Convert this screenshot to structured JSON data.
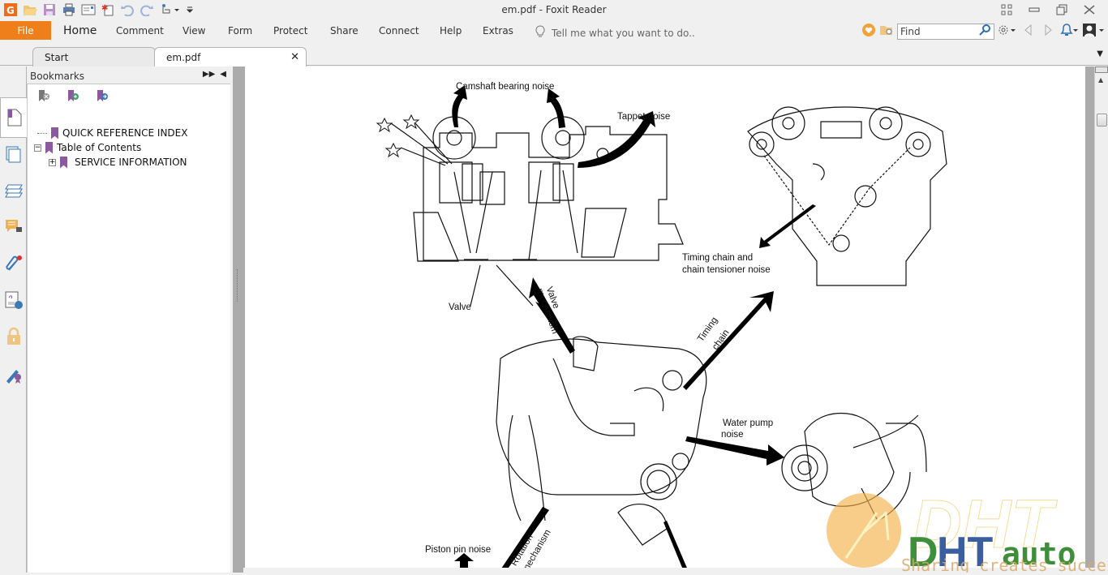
{
  "window": {
    "title": "em.pdf - Foxit Reader"
  },
  "quick_access": [
    "foxit-logo",
    "open-icon",
    "save-icon",
    "print-icon",
    "email-icon",
    "new-icon",
    "undo-icon",
    "redo-icon",
    "hand-tool-icon",
    "customize-icon"
  ],
  "ribbon": {
    "file_label": "File",
    "menus": [
      "Home",
      "Comment",
      "View",
      "Form",
      "Protect",
      "Share",
      "Connect",
      "Help",
      "Extras"
    ],
    "tell_me_placeholder": "Tell me what you want to do..",
    "find_placeholder": "Find"
  },
  "tabs": [
    {
      "label": "Start",
      "active": false
    },
    {
      "label": "em.pdf",
      "active": true
    }
  ],
  "panel": {
    "title": "Bookmarks",
    "tools": [
      "delete-bookmark",
      "add-bookmark",
      "goto-bookmark"
    ],
    "tree": [
      {
        "label": "QUICK REFERENCE INDEX",
        "level": 0,
        "expander": ""
      },
      {
        "label": "Table of Contents",
        "level": 0,
        "expander": "−"
      },
      {
        "label": "SERVICE INFORMATION",
        "level": 1,
        "expander": "+"
      }
    ]
  },
  "rail": [
    "pages",
    "layers",
    "comments",
    "attachments",
    "signatures",
    "security",
    "certify"
  ],
  "document": {
    "labels": {
      "camshaft": "Camshaft bearing noise",
      "tappet": "Tappet noise",
      "timing_chain_tensioner_1": "Timing chain and",
      "timing_chain_tensioner_2": "chain tensioner noise",
      "valve": "Valve",
      "valve_mechanism_1": "Valve",
      "valve_mechanism_2": "mechanism",
      "timing_chain_1": "Timing",
      "timing_chain_2": "chain",
      "water_pump_1": "Water pump",
      "water_pump_2": "noise",
      "piston_pin": "Piston pin noise",
      "rotation_1": "Rotation",
      "rotation_2": "mechanism"
    }
  },
  "watermark": {
    "brand": "DHT",
    "suffix": "auto",
    "tagline": "Sharing creates success"
  },
  "colors": {
    "file_tab": "#ef7f1a",
    "bookmark": "#8b5a9e",
    "wm_green": "#3f8f3a",
    "wm_blue": "#3a5ea0",
    "wm_orange": "#f3b24a"
  }
}
